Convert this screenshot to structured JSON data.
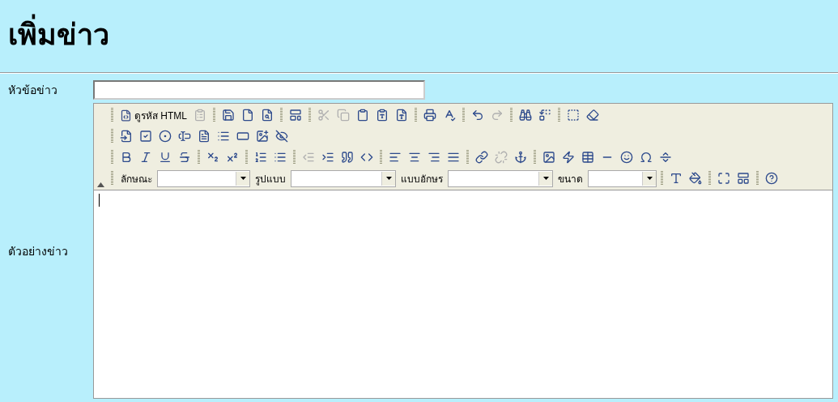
{
  "page": {
    "title": "เพิ่มข่าว"
  },
  "form": {
    "subject": {
      "label": "หัวข้อข่าว"
    },
    "body": {
      "label": "ตัวอย่างข่าว"
    }
  },
  "toolbar": {
    "collapsed": false,
    "rows": [
      {
        "items": [
          {
            "kind": "button",
            "label": "ดูรหัส HTML",
            "disabled": false
          },
          {
            "kind": "icon",
            "disabled": true
          },
          {
            "kind": "separator"
          },
          {
            "kind": "icon",
            "disabled": false
          },
          {
            "kind": "icon",
            "disabled": false
          },
          {
            "kind": "icon",
            "disabled": false
          },
          {
            "kind": "separator"
          },
          {
            "kind": "icon",
            "disabled": false
          },
          {
            "kind": "separator"
          },
          {
            "kind": "icon",
            "disabled": true
          },
          {
            "kind": "icon",
            "disabled": true
          },
          {
            "kind": "icon",
            "disabled": false
          },
          {
            "kind": "icon",
            "disabled": false
          },
          {
            "kind": "icon",
            "disabled": false
          },
          {
            "kind": "separator"
          },
          {
            "kind": "icon",
            "disabled": false
          },
          {
            "kind": "icon",
            "disabled": false
          },
          {
            "kind": "separator"
          },
          {
            "kind": "icon",
            "disabled": false
          },
          {
            "kind": "icon",
            "disabled": true
          },
          {
            "kind": "separator"
          },
          {
            "kind": "icon",
            "disabled": false
          },
          {
            "kind": "icon",
            "disabled": false
          },
          {
            "kind": "separator"
          },
          {
            "kind": "icon",
            "disabled": false
          },
          {
            "kind": "icon",
            "disabled": false
          }
        ]
      },
      {
        "items": [
          {
            "kind": "icon",
            "disabled": false
          },
          {
            "kind": "icon",
            "disabled": false
          },
          {
            "kind": "icon",
            "disabled": false
          },
          {
            "kind": "icon",
            "disabled": false
          },
          {
            "kind": "icon",
            "disabled": false
          },
          {
            "kind": "icon",
            "disabled": false
          },
          {
            "kind": "icon",
            "disabled": false
          },
          {
            "kind": "icon",
            "disabled": false
          },
          {
            "kind": "icon",
            "disabled": false
          }
        ]
      },
      {
        "items": [
          {
            "kind": "icon",
            "disabled": false
          },
          {
            "kind": "icon",
            "disabled": false
          },
          {
            "kind": "icon",
            "disabled": false
          },
          {
            "kind": "icon",
            "disabled": false
          },
          {
            "kind": "separator"
          },
          {
            "kind": "icon",
            "disabled": false
          },
          {
            "kind": "icon",
            "disabled": false
          },
          {
            "kind": "separator"
          },
          {
            "kind": "icon",
            "disabled": false
          },
          {
            "kind": "icon",
            "disabled": false
          },
          {
            "kind": "separator"
          },
          {
            "kind": "icon",
            "disabled": true
          },
          {
            "kind": "icon",
            "disabled": false
          },
          {
            "kind": "icon",
            "disabled": false
          },
          {
            "kind": "icon",
            "disabled": false
          },
          {
            "kind": "separator"
          },
          {
            "kind": "icon",
            "disabled": false
          },
          {
            "kind": "icon",
            "disabled": false
          },
          {
            "kind": "icon",
            "disabled": false
          },
          {
            "kind": "icon",
            "disabled": false
          },
          {
            "kind": "separator"
          },
          {
            "kind": "icon",
            "disabled": false
          },
          {
            "kind": "icon",
            "disabled": true
          },
          {
            "kind": "icon",
            "disabled": false
          },
          {
            "kind": "separator"
          },
          {
            "kind": "icon",
            "disabled": false
          },
          {
            "kind": "icon",
            "disabled": false
          },
          {
            "kind": "icon",
            "disabled": false
          },
          {
            "kind": "icon",
            "disabled": false
          },
          {
            "kind": "icon",
            "disabled": false
          },
          {
            "kind": "icon",
            "disabled": false
          },
          {
            "kind": "icon",
            "disabled": false
          }
        ]
      },
      {
        "items": [
          {
            "kind": "select",
            "label": "ลักษณะ"
          },
          {
            "kind": "select",
            "label": "รูปแบบ"
          },
          {
            "kind": "select",
            "label": "แบบอักษร"
          },
          {
            "kind": "select",
            "label": "ขนาด"
          },
          {
            "kind": "separator"
          },
          {
            "kind": "icon",
            "disabled": false
          },
          {
            "kind": "icon",
            "disabled": false
          },
          {
            "kind": "separator"
          },
          {
            "kind": "icon",
            "disabled": false
          },
          {
            "kind": "icon",
            "disabled": false
          },
          {
            "kind": "separator"
          },
          {
            "kind": "icon",
            "disabled": false
          }
        ]
      }
    ]
  }
}
